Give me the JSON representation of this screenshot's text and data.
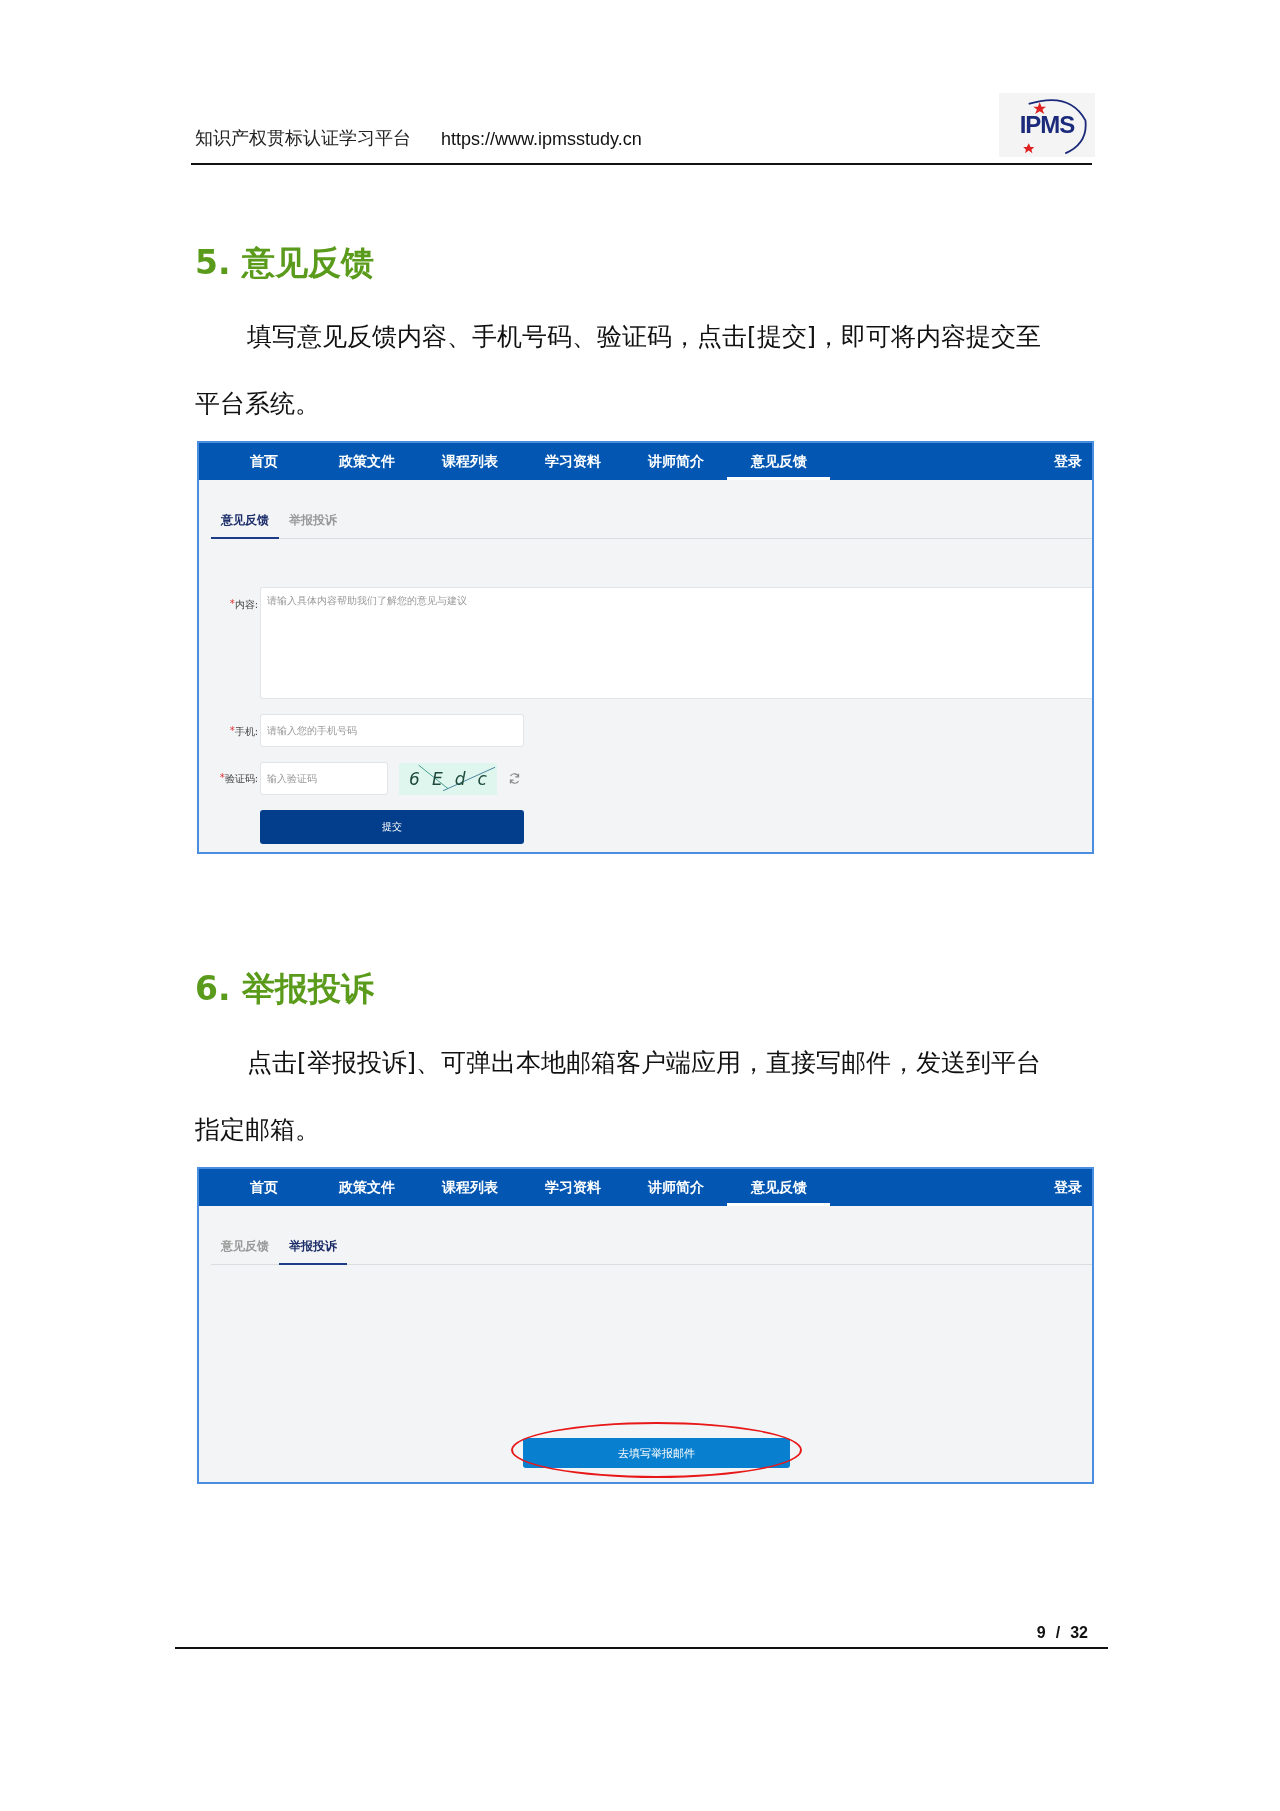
{
  "header": {
    "site_name": "知识产权贯标认证学习平台",
    "url": "https://www.ipmsstudy.cn",
    "logo": "IPMS"
  },
  "sections": [
    {
      "heading": "5. 意见反馈",
      "paragraph": "填写意见反馈内容、手机号码、验证码，点击[提交]，即可将内容提交至平台系统。",
      "screen": {
        "nav": [
          {
            "label": "首页",
            "selected": false
          },
          {
            "label": "政策文件",
            "selected": false
          },
          {
            "label": "课程列表",
            "selected": false
          },
          {
            "label": "学习资料",
            "selected": false
          },
          {
            "label": "讲师简介",
            "selected": false
          },
          {
            "label": "意见反馈",
            "selected": true
          }
        ],
        "login": "登录",
        "tabs": [
          {
            "label": "意见反馈",
            "selected": true
          },
          {
            "label": "举报投诉",
            "selected": false
          }
        ],
        "form": {
          "fields": [
            {
              "kind": "textarea",
              "required_mark": "*",
              "label": "内容:",
              "placeholder": "请输入具体内容帮助我们了解您的意见与建议"
            },
            {
              "kind": "input",
              "required_mark": "*",
              "label": "手机:",
              "placeholder": "请输入您的手机号码"
            },
            {
              "kind": "captcha",
              "required_mark": "*",
              "label": "验证码:",
              "placeholder": "输入验证码",
              "captcha": [
                "6",
                "E",
                "d",
                "c"
              ]
            }
          ],
          "submit": "提交"
        }
      }
    },
    {
      "heading": "6. 举报投诉",
      "paragraph": "点击[举报投诉]、可弹出本地邮箱客户端应用，直接写邮件，发送到平台指定邮箱。",
      "screen": {
        "nav": [
          {
            "label": "首页",
            "selected": false
          },
          {
            "label": "政策文件",
            "selected": false
          },
          {
            "label": "课程列表",
            "selected": false
          },
          {
            "label": "学习资料",
            "selected": false
          },
          {
            "label": "讲师简介",
            "selected": false
          },
          {
            "label": "意见反馈",
            "selected": true
          }
        ],
        "login": "登录",
        "tabs": [
          {
            "label": "意见反馈",
            "selected": false
          },
          {
            "label": "举报投诉",
            "selected": true
          }
        ],
        "action": {
          "label": "去填写举报邮件",
          "highlighted": true
        }
      }
    }
  ],
  "footer": {
    "page": "9",
    "separator": "/",
    "total": "32"
  }
}
